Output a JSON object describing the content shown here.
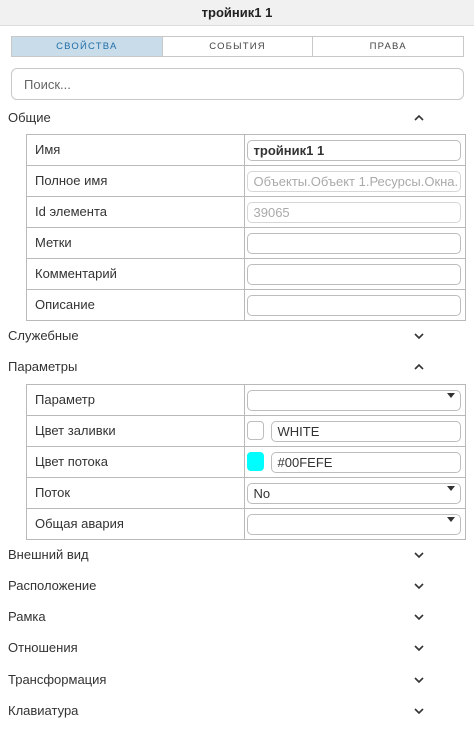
{
  "header": {
    "title": "тройник1 1"
  },
  "tabs": [
    {
      "label": "СВОЙСТВА",
      "active": true
    },
    {
      "label": "СОБЫТИЯ",
      "active": false
    },
    {
      "label": "ПРАВА",
      "active": false
    }
  ],
  "search": {
    "placeholder": "Поиск...",
    "value": ""
  },
  "sections": {
    "general": {
      "label": "Общие",
      "expanded": true,
      "rows": [
        {
          "label": "Имя",
          "value": "тройник1 1"
        },
        {
          "label": "Полное имя",
          "value": "Объекты.Объект 1.Ресурсы.Окна."
        },
        {
          "label": "Id элемента",
          "value": "39065"
        },
        {
          "label": "Метки",
          "value": ""
        },
        {
          "label": "Комментарий",
          "value": ""
        },
        {
          "label": "Описание",
          "value": ""
        }
      ]
    },
    "service": {
      "label": "Служебные",
      "expanded": false
    },
    "params": {
      "label": "Параметры",
      "expanded": true,
      "rows": [
        {
          "label": "Параметр",
          "value": ""
        },
        {
          "label": "Цвет заливки",
          "value": "WHITE",
          "color": "#ffffff"
        },
        {
          "label": "Цвет потока",
          "value": "#00FEFE",
          "color": "#00fefe"
        },
        {
          "label": "Поток",
          "value": "No"
        },
        {
          "label": "Общая авария",
          "value": ""
        }
      ]
    },
    "appearance": {
      "label": "Внешний вид",
      "expanded": false
    },
    "position": {
      "label": "Расположение",
      "expanded": false
    },
    "frame": {
      "label": "Рамка",
      "expanded": false
    },
    "relations": {
      "label": "Отношения",
      "expanded": false
    },
    "transform": {
      "label": "Трансформация",
      "expanded": false
    },
    "keyboard": {
      "label": "Клавиатура",
      "expanded": false
    }
  },
  "colors": {
    "accent": "#1f6fa8",
    "tab_active_bg": "#c9dcea"
  }
}
